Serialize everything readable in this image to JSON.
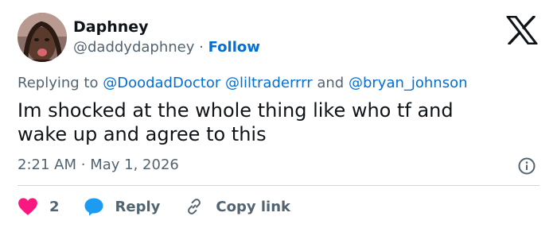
{
  "user": {
    "name": "Daphney",
    "handle": "@daddydaphney",
    "separator": "·",
    "follow_label": "Follow"
  },
  "brand": {
    "logo_icon": "x-logo-icon"
  },
  "reply_context": {
    "prefix": "Replying to",
    "mentions": [
      "@DoodadDoctor",
      "@liltraderrrr",
      "@bryan_johnson"
    ],
    "conjunction": "and"
  },
  "tweet": {
    "line1": "Im shocked at the whole thing like who tf and",
    "line2": "wake up and agree to this",
    "time": "2:21 AM",
    "dot": "·",
    "date": "May 1, 2026"
  },
  "actions": {
    "like_count": "2",
    "reply_label": "Reply",
    "copy_label": "Copy link"
  },
  "colors": {
    "link": "#006fd6",
    "like": "#f91880",
    "reply": "#1d9bf0",
    "muted": "#536471",
    "text": "#0f1419"
  }
}
